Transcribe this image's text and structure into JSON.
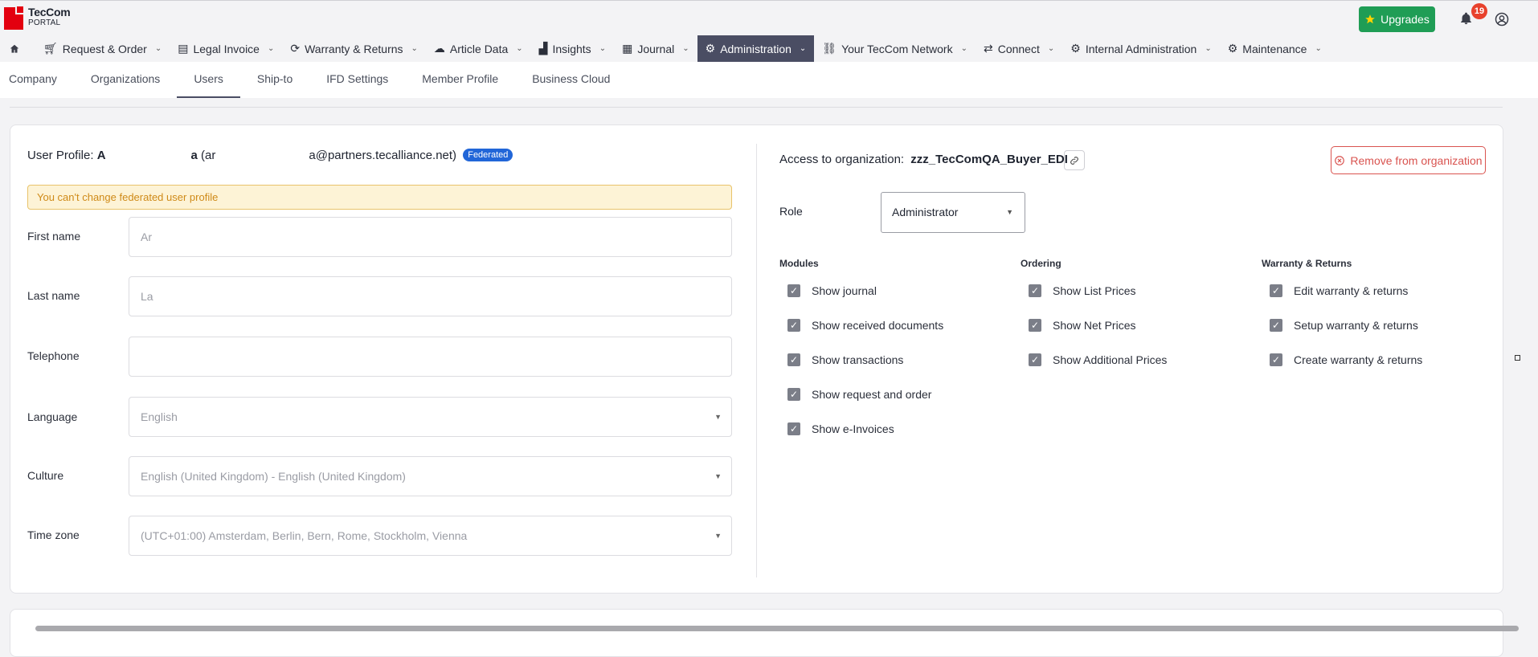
{
  "header": {
    "logo_line1": "TecCom",
    "logo_line2": "PORTAL",
    "upgrades_label": "Upgrades",
    "notification_count": "19"
  },
  "nav": {
    "items": [
      {
        "label": "Request & Order",
        "icon": "cart-icon"
      },
      {
        "label": "Legal Invoice",
        "icon": "invoice-icon"
      },
      {
        "label": "Warranty & Returns",
        "icon": "cycle-icon"
      },
      {
        "label": "Article Data",
        "icon": "cloud-icon"
      },
      {
        "label": "Insights",
        "icon": "chart-icon"
      },
      {
        "label": "Journal",
        "icon": "table-icon"
      },
      {
        "label": "Administration",
        "icon": "gear-icon"
      },
      {
        "label": "Your TecCom Network",
        "icon": "link-icon"
      },
      {
        "label": "Connect",
        "icon": "arrows-icon"
      },
      {
        "label": "Internal Administration",
        "icon": "gears-icon"
      },
      {
        "label": "Maintenance",
        "icon": "gears-icon"
      }
    ],
    "active_index": 6
  },
  "subtabs": [
    "Company",
    "Organizations",
    "Users",
    "Ship-to",
    "IFD Settings",
    "Member Profile",
    "Business Cloud"
  ],
  "profile": {
    "prefix": "User Profile: ",
    "name_visible": "A",
    "name_end": "a",
    "email_start": " (ar",
    "email_end": "a@partners.tecalliance.net)",
    "badge": "Federated",
    "warning": "You can't change federated user profile",
    "fields": {
      "first_name_label": "First name",
      "first_name_value": "Ar",
      "last_name_label": "Last name",
      "last_name_value": "La",
      "telephone_label": "Telephone",
      "telephone_value": "",
      "language_label": "Language",
      "language_value": "English",
      "culture_label": "Culture",
      "culture_value": "English (United Kingdom) - English (United Kingdom)",
      "timezone_label": "Time zone",
      "timezone_value": "(UTC+01:00) Amsterdam, Berlin, Bern, Rome, Stockholm, Vienna"
    }
  },
  "access": {
    "label": "Access to organization:",
    "org": "zzz_TecComQA_Buyer_EDI",
    "remove_label": "Remove from organization",
    "role_label": "Role",
    "role_value": "Administrator"
  },
  "permissions": {
    "modules": {
      "title": "Modules",
      "items": [
        "Show journal",
        "Show received documents",
        "Show transactions",
        "Show request and order",
        "Show e-Invoices"
      ]
    },
    "ordering": {
      "title": "Ordering",
      "items": [
        "Show List Prices",
        "Show Net Prices",
        "Show Additional Prices"
      ]
    },
    "warranty": {
      "title": "Warranty & Returns",
      "items": [
        "Edit warranty & returns",
        "Setup warranty & returns",
        "Create warranty & returns"
      ]
    }
  },
  "colors": {
    "nav_active_bg": "#4a4d63",
    "upgrades_bg": "#1f9d55",
    "badge_bg": "#2166d8",
    "danger": "#d9534f",
    "warning_bg": "#fdf3d6"
  }
}
